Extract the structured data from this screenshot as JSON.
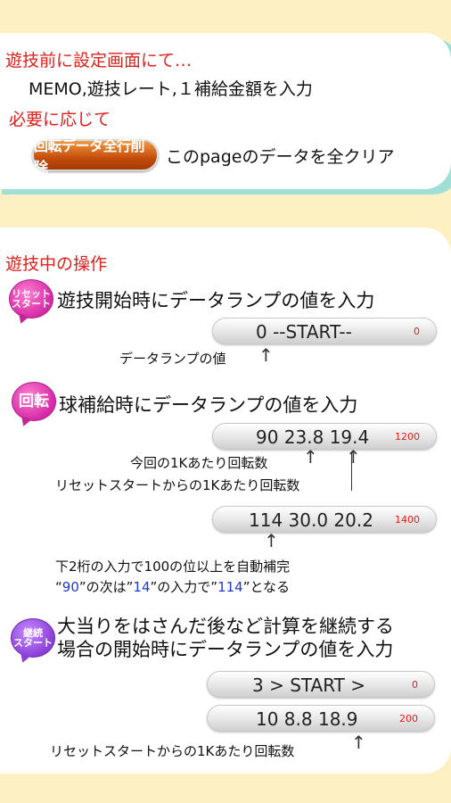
{
  "setup": {
    "heading": "遊技前に設定画面にて…",
    "line1": "MEMO,遊技レート,１補給金額を入力",
    "line2": "必要に応じて",
    "clear_button": "回転データ全行削除",
    "clear_desc": "このpageのデータを全クリア"
  },
  "ops": {
    "heading": "遊技中の操作",
    "reset_badge": [
      "リセット",
      "スタート"
    ],
    "reset_desc": "遊技開始時にデータランプの値を入力",
    "lamp1": {
      "value": "0 --START--",
      "count": "0"
    },
    "lamp1_note": "データランプの値",
    "rotate_badge": "回転",
    "rotate_desc": "球補給時にデータランプの値を入力",
    "lamp2": {
      "value": "90 23.8 19.4",
      "count": "1200"
    },
    "note_now": "今回の1Kあたり回転数",
    "note_reset": "リセットスタートからの1Kあたり回転数",
    "lamp3": {
      "value": "114 30.0 20.2",
      "count": "1400"
    },
    "complete_line1": "下2桁の入力で100の位以上を自動補完",
    "complete_line2": {
      "q1": "“",
      "v1": "90",
      "q2": "”の次は”",
      "v2": "14",
      "q3": "”の入力で”",
      "v3": "114",
      "q4": "”となる"
    },
    "continue_badge": [
      "継続",
      "スタート"
    ],
    "continue_desc1": "大当りをはさんだ後など計算を継続する",
    "continue_desc2": "場合の開始時にデータランプの値を入力",
    "lamp4": {
      "value": "3 > START >",
      "count": "0"
    },
    "lamp5": {
      "value": "10  8.8 18.9",
      "count": "200"
    },
    "note_reset2": "リセットスタートからの1Kあたり回転数"
  },
  "colors": {
    "background": "#fdf1c4",
    "accent_red": "#e0201c",
    "shadow_teal": "#9fdfd5",
    "badge_pink": "#d42aa6",
    "badge_purple": "#8b3fd6",
    "button_orange": "#c44d0a",
    "highlight_blue": "#1c3ad8"
  }
}
